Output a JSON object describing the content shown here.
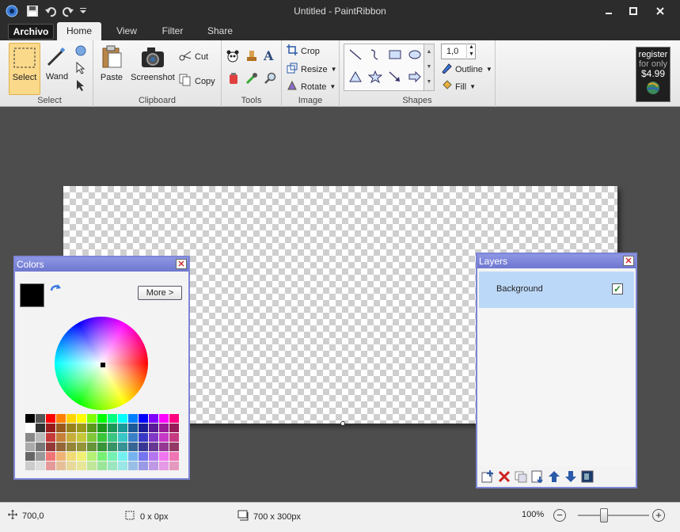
{
  "window": {
    "title": "Untitled - PaintRibbon"
  },
  "tabs": {
    "file": "Archivo",
    "home": "Home",
    "view": "View",
    "filter": "Filter",
    "share": "Share"
  },
  "ribbon": {
    "select": {
      "select_label": "Select",
      "wand_label": "Wand",
      "group": "Select"
    },
    "clipboard": {
      "paste": "Paste",
      "screenshot": "Screenshot",
      "cut": "Cut",
      "copy": "Copy",
      "group": "Clipboard"
    },
    "tools": {
      "group": "Tools"
    },
    "image": {
      "crop": "Crop",
      "resize": "Resize",
      "rotate": "Rotate",
      "group": "Image"
    },
    "shapes": {
      "width_value": "1,0",
      "outline": "Outline",
      "fill": "Fill",
      "group": "Shapes"
    },
    "register": {
      "line1": "register",
      "line2": "for only",
      "price": "$4.99"
    }
  },
  "colors_panel": {
    "title": "Colors",
    "more": "More >",
    "primary": "#000000",
    "secondary": "#ffffff"
  },
  "layers_panel": {
    "title": "Layers",
    "layer": "Background"
  },
  "status": {
    "position": "700,0",
    "selection": "0 x 0px",
    "size": "700 x 300px",
    "zoom": "100%"
  }
}
